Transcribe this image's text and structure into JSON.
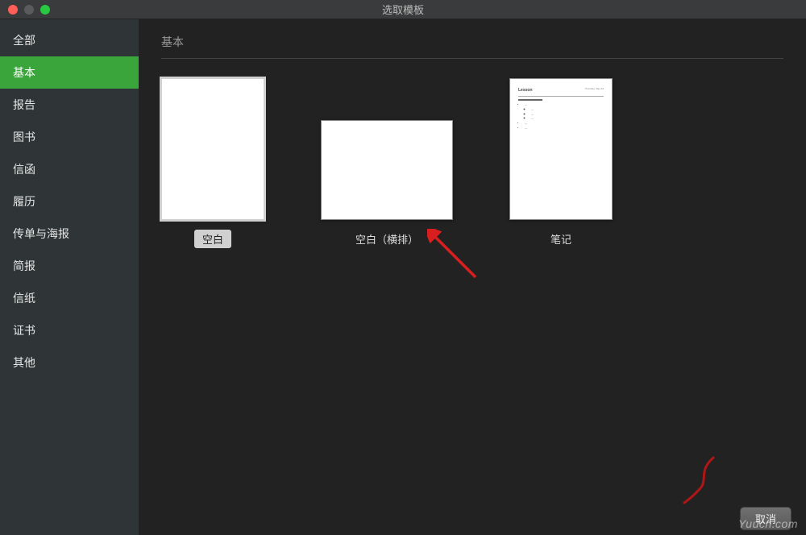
{
  "window": {
    "title": "选取模板"
  },
  "sidebar": {
    "items": [
      {
        "label": "全部"
      },
      {
        "label": "基本"
      },
      {
        "label": "报告"
      },
      {
        "label": "图书"
      },
      {
        "label": "信函"
      },
      {
        "label": "履历"
      },
      {
        "label": "传单与海报"
      },
      {
        "label": "简报"
      },
      {
        "label": "信纸"
      },
      {
        "label": "证书"
      },
      {
        "label": "其他"
      }
    ],
    "active_index": 1
  },
  "section": {
    "title": "基本"
  },
  "templates": [
    {
      "label": "空白",
      "orientation": "portrait",
      "selected": true
    },
    {
      "label": "空白（横排）",
      "orientation": "landscape",
      "selected": false
    },
    {
      "label": "笔记",
      "orientation": "portrait",
      "selected": false
    }
  ],
  "note_preview": {
    "title": "Lesson",
    "date": "Thursday, May 20"
  },
  "footer": {
    "cancel": "取消"
  },
  "watermark": "Yuucn.com"
}
